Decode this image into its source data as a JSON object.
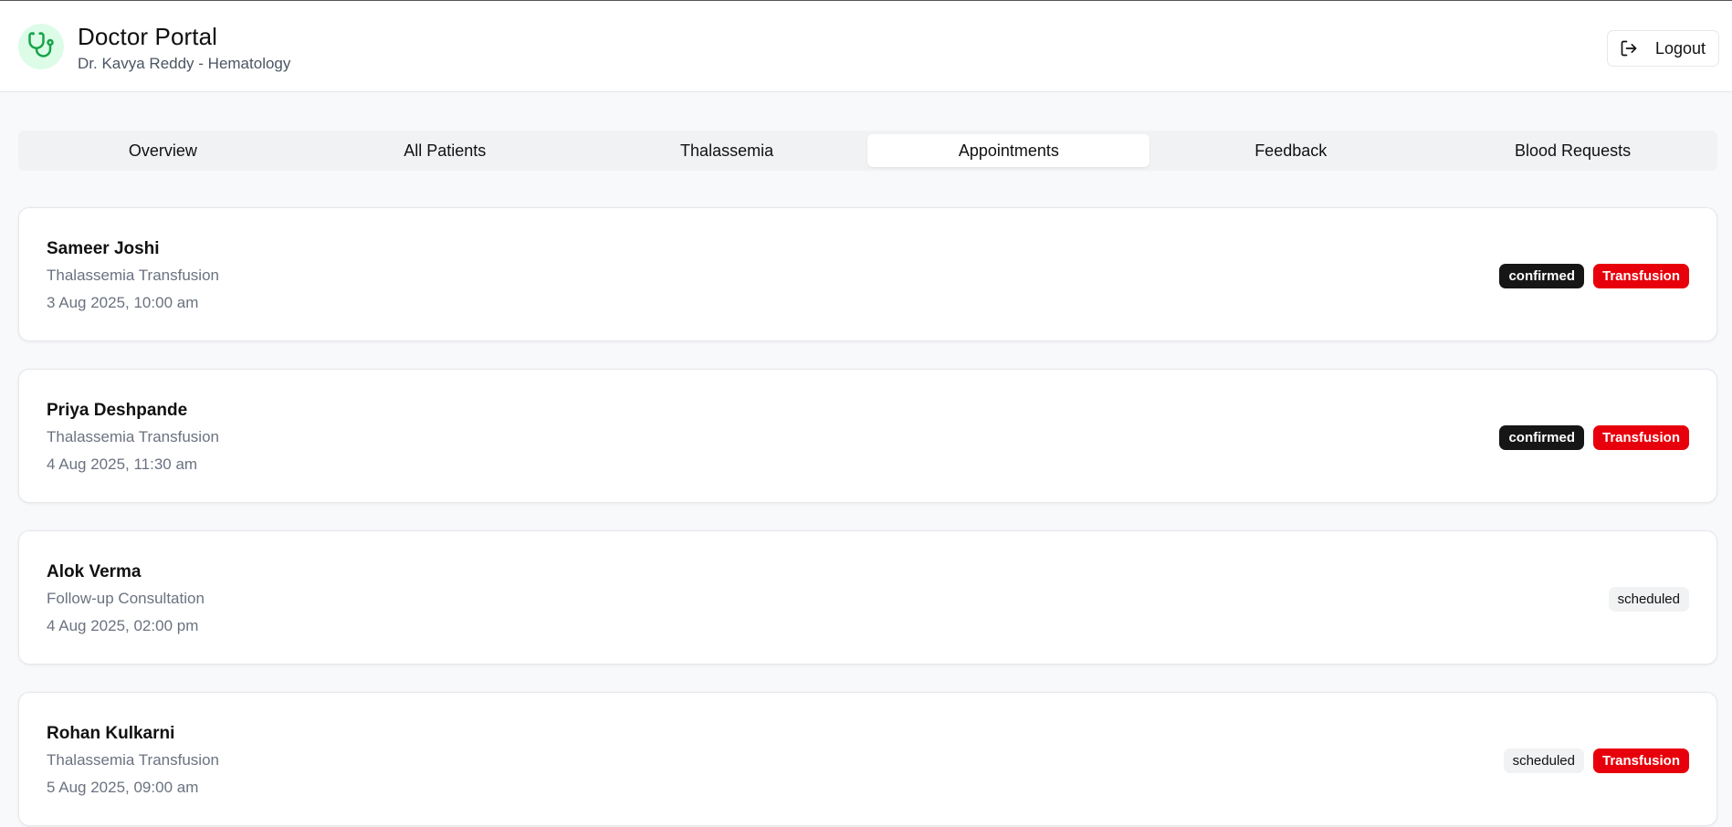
{
  "header": {
    "title": "Doctor Portal",
    "subtitle": "Dr. Kavya Reddy - Hematology",
    "logo_icon": "stethoscope-icon",
    "logout_label": "Logout",
    "logout_icon": "logout-icon"
  },
  "tabs": [
    {
      "label": "Overview"
    },
    {
      "label": "All Patients"
    },
    {
      "label": "Thalassemia"
    },
    {
      "label": "Appointments"
    },
    {
      "label": "Feedback"
    },
    {
      "label": "Blood Requests"
    }
  ],
  "active_tab": "Appointments",
  "appointments": [
    {
      "patient": "Sameer Joshi",
      "type": "Thalassemia Transfusion",
      "datetime": "3 Aug 2025, 10:00 am",
      "status": "confirmed",
      "tag": "Transfusion"
    },
    {
      "patient": "Priya Deshpande",
      "type": "Thalassemia Transfusion",
      "datetime": "4 Aug 2025, 11:30 am",
      "status": "confirmed",
      "tag": "Transfusion"
    },
    {
      "patient": "Alok Verma",
      "type": "Follow-up Consultation",
      "datetime": "4 Aug 2025, 02:00 pm",
      "status": "scheduled",
      "tag": ""
    },
    {
      "patient": "Rohan Kulkarni",
      "type": "Thalassemia Transfusion",
      "datetime": "5 Aug 2025, 09:00 am",
      "status": "scheduled",
      "tag": "Transfusion"
    }
  ],
  "colors": {
    "brand": "#16a34a",
    "brand_bg": "#dcfce7",
    "confirmed_badge": "#161616",
    "transfusion_badge": "#e7000b",
    "scheduled_badge": "#f1f2f4"
  }
}
